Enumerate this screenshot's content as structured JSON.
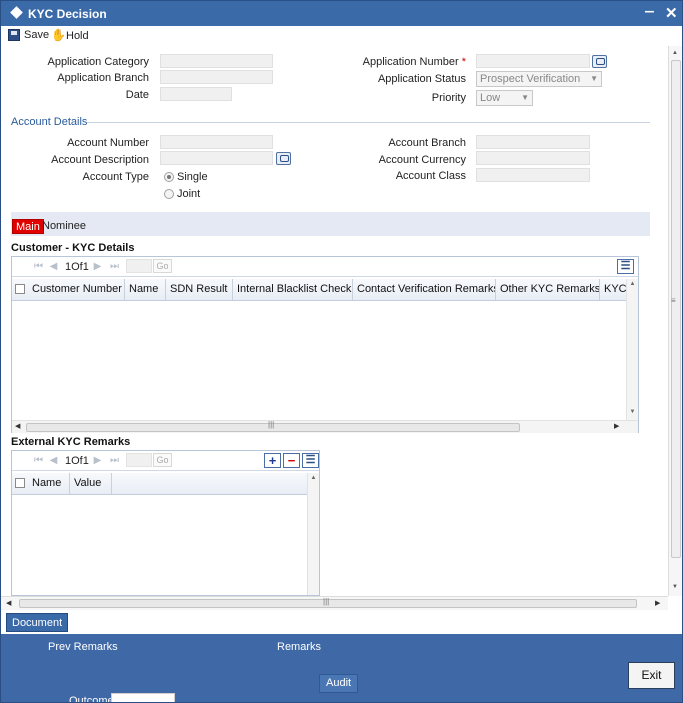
{
  "window": {
    "title": "KYC Decision"
  },
  "toolbar": {
    "save_label": "Save",
    "hold_label": "Hold"
  },
  "header_form": {
    "application_category_label": "Application Category",
    "application_branch_label": "Application Branch",
    "date_label": "Date",
    "application_number_label": "Application Number",
    "required_mark": "*",
    "application_status_label": "Application Status",
    "application_status_value": "Prospect Verification",
    "priority_label": "Priority",
    "priority_value": "Low"
  },
  "account_details": {
    "section_title": "Account Details",
    "account_number_label": "Account Number",
    "account_description_label": "Account Description",
    "account_type_label": "Account Type",
    "type_single_label": "Single",
    "type_joint_label": "Joint",
    "account_branch_label": "Account Branch",
    "account_currency_label": "Account Currency",
    "account_class_label": "Account Class"
  },
  "tabs": [
    {
      "label": "Main",
      "active": true
    },
    {
      "label": "Nominee",
      "active": false
    }
  ],
  "customer_kyc": {
    "title": "Customer - KYC Details",
    "pager": {
      "current": "1",
      "of_label": "Of",
      "total": "1",
      "go_label": "Go"
    },
    "columns": [
      "Customer Number",
      "Name",
      "SDN Result",
      "Internal Blacklist Check",
      "Contact Verification Remarks",
      "Other KYC Remarks",
      "KYC"
    ]
  },
  "external_kyc": {
    "title": "External KYC Remarks",
    "pager": {
      "current": "1",
      "of_label": "Of",
      "total": "1",
      "go_label": "Go"
    },
    "columns": [
      "Name",
      "Value"
    ]
  },
  "bottom": {
    "document_label": "Document",
    "prev_remarks_label": "Prev Remarks",
    "remarks_label": "Remarks",
    "audit_label": "Audit",
    "exit_label": "Exit",
    "outcome_label": "Outcome"
  },
  "colors": {
    "titlebar": "#3a6aa8",
    "footer": "#3f69a6",
    "active_tab": "#e00000",
    "section_title": "#2a5b9c"
  }
}
